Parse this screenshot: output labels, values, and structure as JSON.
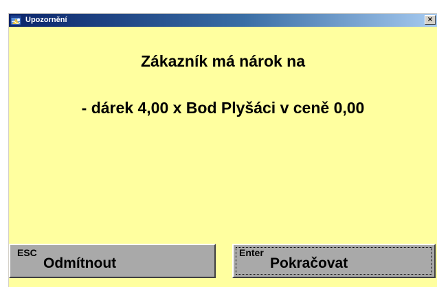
{
  "window": {
    "title": "Upozornění",
    "close_label": "×"
  },
  "message": {
    "line1": "Zákazník má nárok na",
    "line2": "- dárek  4,00 x Bod Plyšáci v ceně 0,00"
  },
  "buttons": {
    "reject": {
      "hotkey": "ESC",
      "label": "Odmítnout"
    },
    "continue": {
      "hotkey": "Enter",
      "label": "Pokračovat"
    }
  },
  "colors": {
    "background": "#ffff9f",
    "titlebar_start": "#0a246a",
    "titlebar_end": "#a6caf0",
    "button_face": "#a9a9a9"
  },
  "icons": {
    "app": "app-window-icon",
    "close": "close-icon"
  }
}
